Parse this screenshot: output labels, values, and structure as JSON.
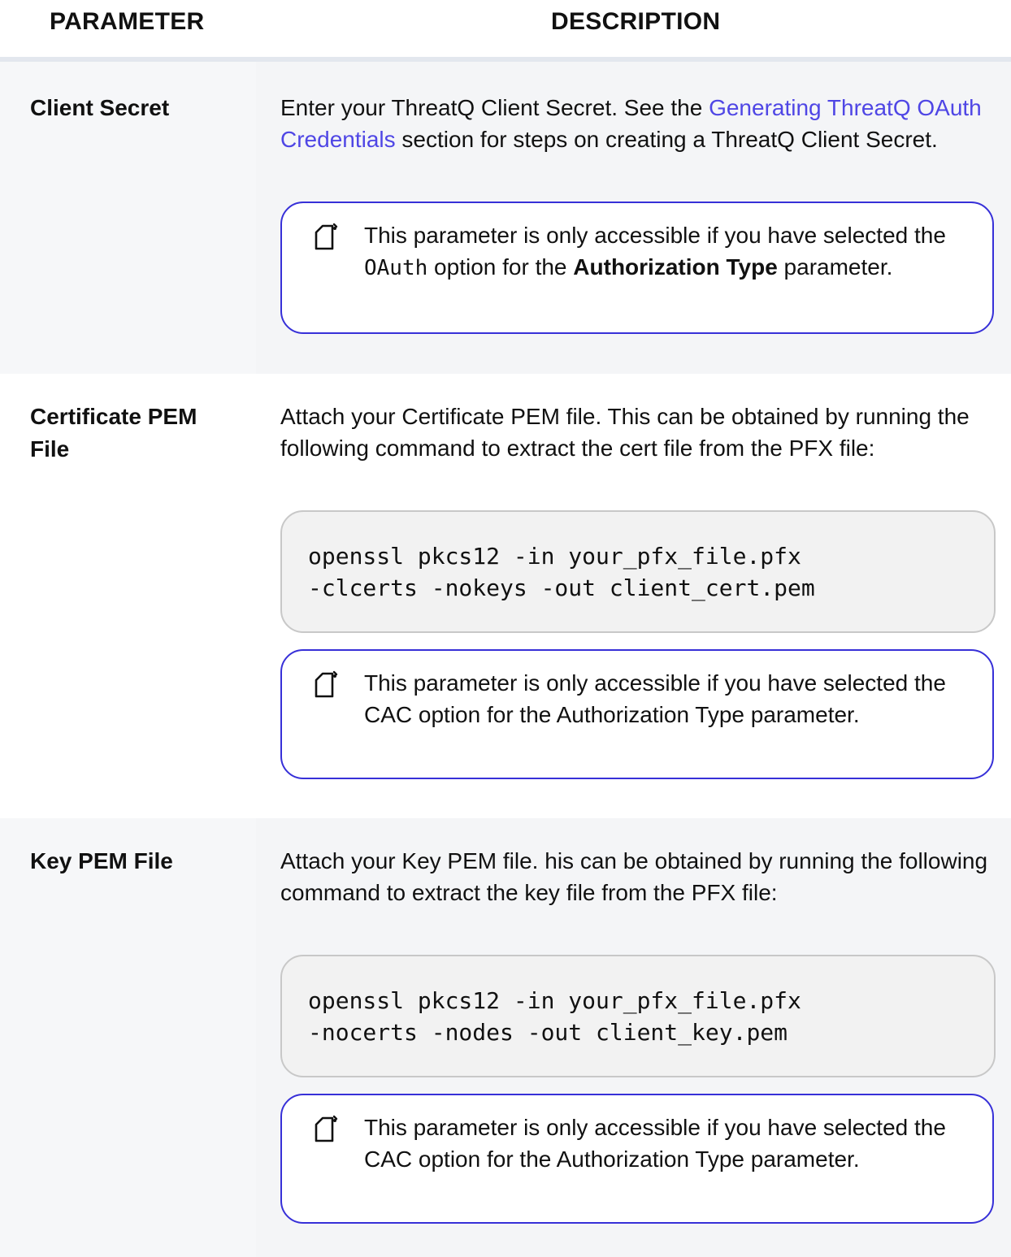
{
  "header": {
    "parameter": "PARAMETER",
    "description": "DESCRIPTION"
  },
  "rows": [
    {
      "name": "Client Secret",
      "desc_before": "Enter your ThreatQ Client Secret. See the ",
      "desc_link": "Generating ThreatQ OAuth Credentials",
      "desc_after": " section for steps on creating a ThreatQ Client Secret.",
      "note": {
        "icon": "note-icon",
        "before": "This parameter is only accessible if you have selected the ",
        "code": "OAuth",
        "middle": " option for the ",
        "bold": "Authorization Type",
        "after": " parameter."
      }
    },
    {
      "name": "Certificate PEM File",
      "desc": "Attach your Certificate PEM file. This can be obtained by running the following command to extract the cert file from the PFX file:",
      "code_lines": [
        "openssl pkcs12 -in your_pfx_file.pfx",
        "-clcerts -nokeys -out client_cert.pem"
      ],
      "note": {
        "icon": "note-icon",
        "text": "This parameter is only accessible if you have selected the CAC option for the Authorization Type parameter."
      }
    },
    {
      "name": "Key PEM File",
      "desc": "Attach your Key PEM file. his can be obtained by running the following command to extract the key file from the PFX file:",
      "code_lines": [
        "openssl pkcs12 -in your_pfx_file.pfx",
        "-nocerts -nodes -out client_key.pem"
      ],
      "note": {
        "icon": "note-icon",
        "text": "This parameter is only accessible if you have selected the CAC option for the Authorization Type parameter."
      }
    }
  ],
  "colors": {
    "link": "#4f46e5",
    "note_border": "#3730d8",
    "code_bg": "#f2f2f2"
  }
}
